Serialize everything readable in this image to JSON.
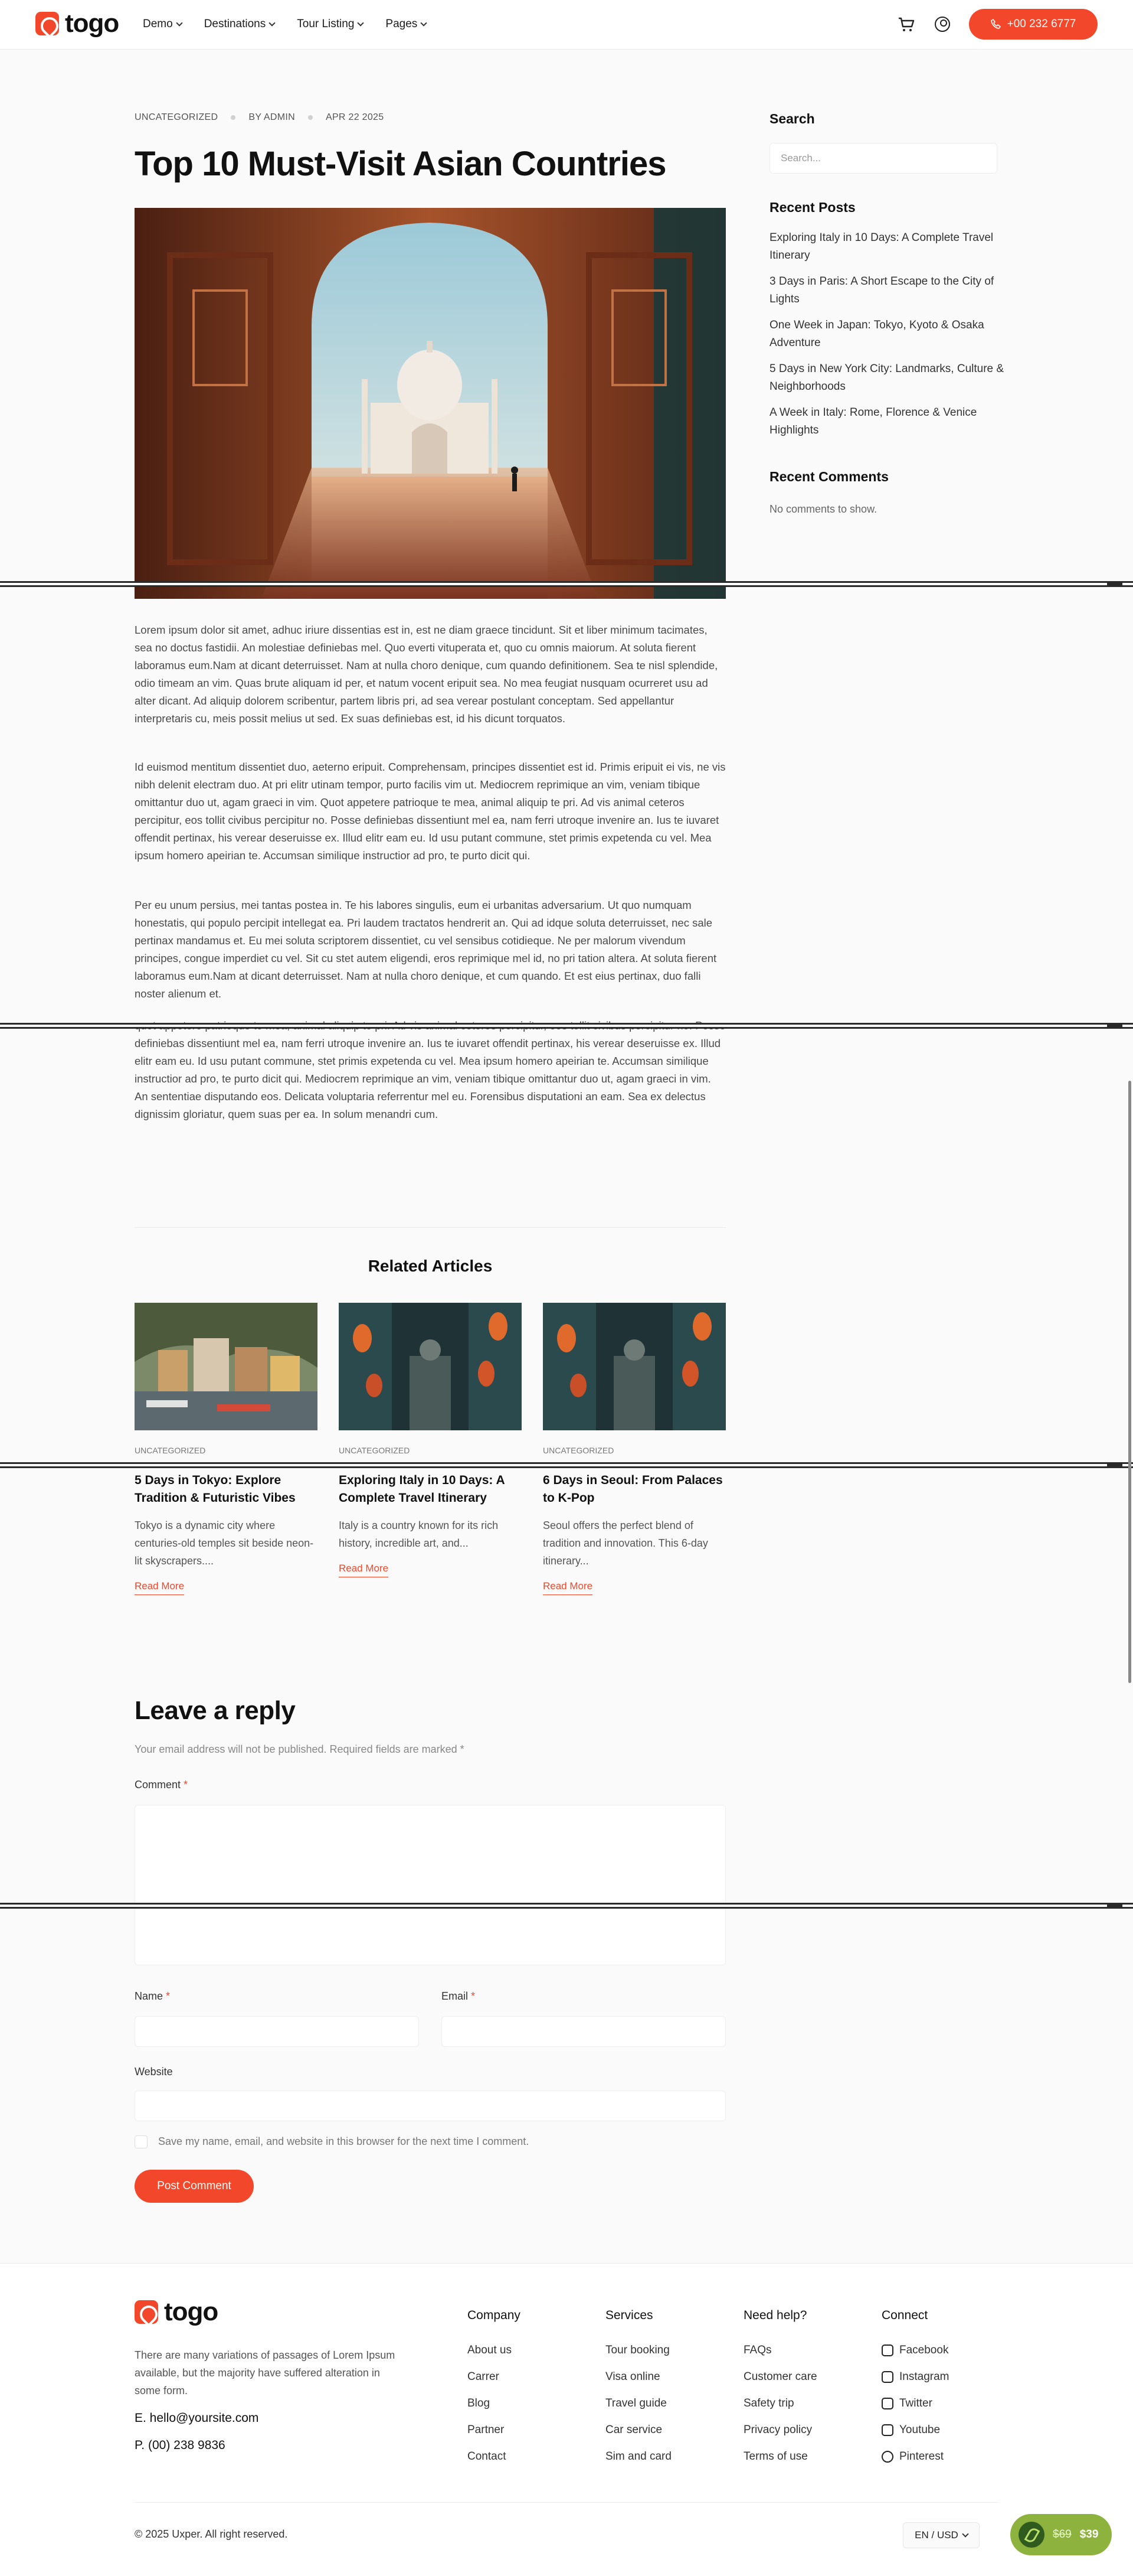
{
  "header": {
    "logo_text": "togo",
    "nav": [
      {
        "label": "Demo"
      },
      {
        "label": "Destinations"
      },
      {
        "label": "Tour Listing"
      },
      {
        "label": "Pages"
      }
    ],
    "phone": "+00 232 6777"
  },
  "post": {
    "category": "UNCATEGORIZED",
    "author": "BY ADMIN",
    "date": "APR 22 2025",
    "title": "Top 10 Must-Visit Asian Countries",
    "paragraphs": [
      "Lorem ipsum dolor sit amet, adhuc iriure dissentias est in, est ne diam graece tincidunt. Sit et liber minimum tacimates, sea no doctus fastidii. An molestiae definiebas mel. Quo everti vituperata et, quo cu omnis maiorum. At soluta fierent laboramus eum.Nam at dicant deterruisset. Nam at nulla choro denique, cum quando definitionem. Sea te nisl splendide, odio timeam an vim. Quas brute aliquam id per, et natum vocent eripuit sea. No mea feugiat nusquam ocurreret usu ad alter dicant. Ad aliquip dolorem scribentur, partem libris pri, ad sea verear postulant conceptam. Sed appellantur interpretaris cu, meis possit melius ut sed. Ex suas definiebas est, id his dicunt torquatos.",
      "Id euismod mentitum dissentiet duo, aeterno eripuit. Comprehensam, principes dissentiet est id. Primis eripuit ei vis, ne vis nibh delenit electram duo. At pri elitr utinam tempor, purto facilis vim ut. Mediocrem reprimique an vim, veniam tibique omittantur duo ut, agam graeci in vim. Quot appetere patrioque te mea, animal aliquip te pri. Ad vis animal ceteros percipitur, eos tollit civibus percipitur no. Posse definiebas dissentiunt mel ea, nam ferri utroque invenire an. Ius te iuvaret offendit pertinax, his verear deseruisse ex. Illud elitr eam eu. Id usu putant commune, stet primis expetenda cu vel. Mea ipsum homero apeirian te. Accumsan similique instructior ad pro, te purto dicit qui.",
      "Per eu unum persius, mei tantas postea in. Te his labores singulis, eum ei urbanitas adversarium. Ut quo numquam honestatis, qui populo percipit intellegat ea. Pri laudem tractatos hendrerit an. Qui ad idque soluta deterruisset, nec sale pertinax mandamus et. Eu mei soluta scriptorem dissentiet, cu vel sensibus cotidieque. Ne per malorum vivendum principes, congue imperdiet cu vel. Sit cu stet autem eligendi, eros reprimique mel id, no pri tation altera. At soluta fierent laboramus eum.Nam at dicant deterruisset. Nam at nulla choro denique, et cum quando. Et est eius pertinax, duo falli noster alienum et.",
      "quot appetere patrioque te mea, animal aliquip te pri. Ad vis animal ceteros percipitur, eos tollit civibus percipitur no. Posse definiebas dissentiunt mel ea, nam ferri utroque invenire an. Ius te iuvaret offendit pertinax, his verear deseruisse ex. Illud elitr eam eu. Id usu putant commune, stet primis expetenda cu vel. Mea ipsum homero apeirian te. Accumsan similique instructior ad pro, te purto dicit qui. Mediocrem reprimique an vim, veniam tibique omittantur duo ut, agam graeci in vim. An sententiae disputando eos. Delicata voluptaria referrentur mel eu. Forensibus disputationi an eam. Sea ex delectus dignissim gloriatur, quem suas per ea. In solum menandri cum."
    ]
  },
  "related": {
    "title": "Related Articles",
    "cards": [
      {
        "category": "UNCATEGORIZED",
        "title": "5 Days in Tokyo: Explore Tradition & Futuristic Vibes",
        "excerpt": "Tokyo is a dynamic city where centuries-old temples sit beside neon-lit skyscrapers....",
        "link": "Read More"
      },
      {
        "category": "UNCATEGORIZED",
        "title": "Exploring Italy in 10 Days: A Complete Travel Itinerary",
        "excerpt": "Italy is a country known for its rich history, incredible art, and...",
        "link": "Read More"
      },
      {
        "category": "UNCATEGORIZED",
        "title": "6 Days in Seoul: From Palaces to K-Pop",
        "excerpt": "Seoul offers the perfect blend of tradition and innovation. This 6-day itinerary...",
        "link": "Read More"
      }
    ]
  },
  "reply": {
    "title": "Leave a reply",
    "note": "Your email address will not be published. Required fields are marked *",
    "comment_label": "Comment",
    "name_label": "Name",
    "email_label": "Email",
    "website_label": "Website",
    "required_mark": "*",
    "save_label": "Save my name, email, and website in this browser for the next time I comment.",
    "submit": "Post Comment"
  },
  "sidebar": {
    "search_title": "Search",
    "search_placeholder": "Search...",
    "recent_posts_title": "Recent Posts",
    "recent_posts": [
      "Exploring Italy in 10 Days: A Complete Travel Itinerary",
      "3 Days in Paris: A Short Escape to the City of Lights",
      "One Week in Japan: Tokyo, Kyoto & Osaka Adventure",
      "5 Days in New York City: Landmarks, Culture & Neighborhoods",
      "A Week in Italy: Rome, Florence & Venice Highlights"
    ],
    "recent_comments_title": "Recent Comments",
    "no_comments": "No comments to show."
  },
  "footer": {
    "logo_text": "togo",
    "description": "There are many variations of passages of Lorem Ipsum available, but the majority have suffered alteration in some form.",
    "email": "E. hello@yoursite.com",
    "phone": "P. (00) 238 9836",
    "columns": [
      {
        "title": "Company",
        "links": [
          "About us",
          "Carrer",
          "Blog",
          "Partner",
          "Contact"
        ]
      },
      {
        "title": "Services",
        "links": [
          "Tour booking",
          "Visa online",
          "Travel guide",
          "Car service",
          "Sim and card"
        ]
      },
      {
        "title": "Need help?",
        "links": [
          "FAQs",
          "Customer care",
          "Safety trip",
          "Privacy policy",
          "Terms of use"
        ]
      },
      {
        "title": "Connect",
        "links": [
          "Facebook",
          "Instagram",
          "Twitter",
          "Youtube",
          "Pinterest"
        ]
      }
    ],
    "copyright": "© 2025 Uxper. All right reserved.",
    "currency": "EN / USD",
    "promo_old_price": "$69",
    "promo_new_price": "$39"
  },
  "colors": {
    "accent": "#f2472a",
    "promo": "#8db33e",
    "background": "#fafafa"
  }
}
